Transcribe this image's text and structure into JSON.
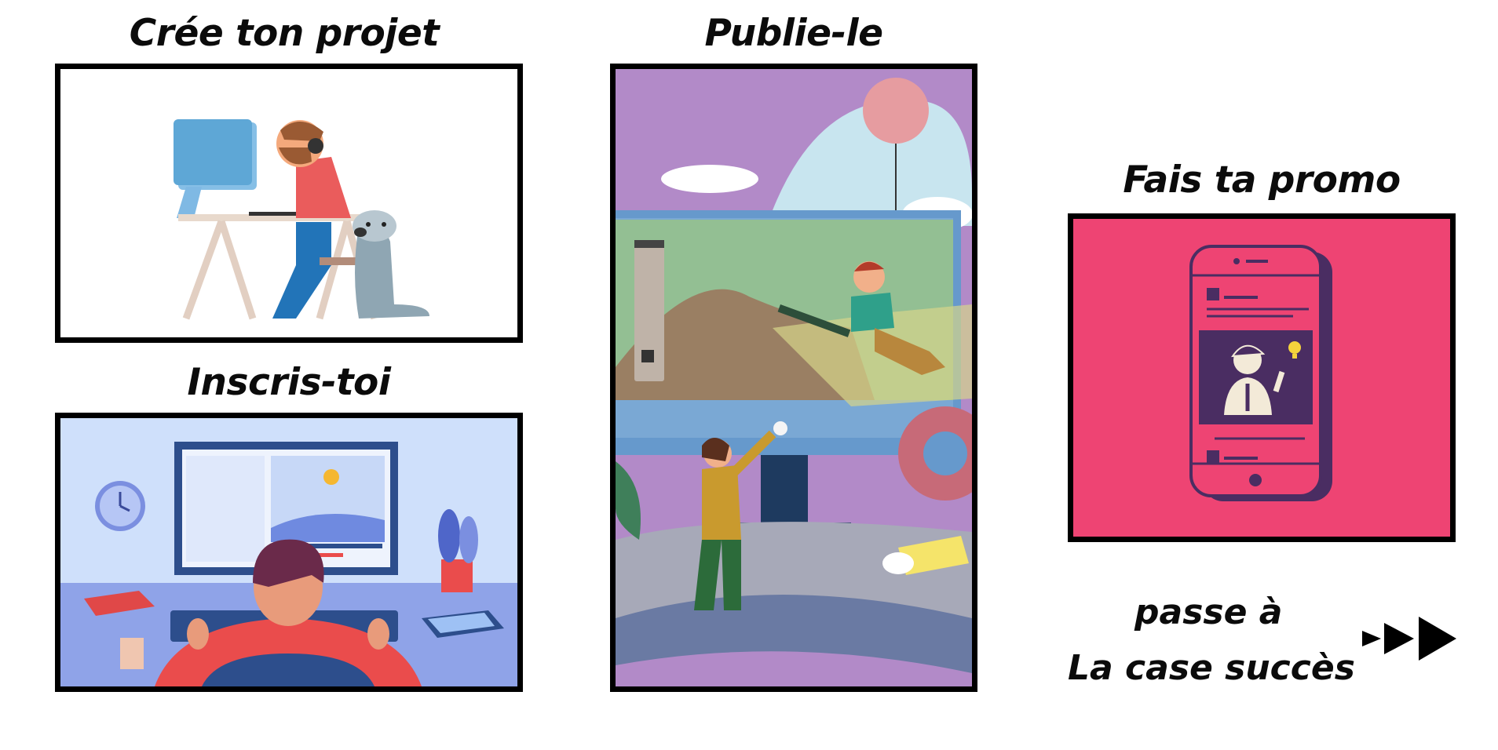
{
  "steps": [
    {
      "title": "Crée ton projet"
    },
    {
      "title": "Inscris-toi"
    },
    {
      "title": "Publie-le"
    },
    {
      "title": "Fais ta promo"
    }
  ],
  "cta": {
    "line1": "passe à",
    "line2": "La case succès",
    "arrow_icon": "triple-play-arrow-icon"
  },
  "colors": {
    "promo_bg": "#ee4473",
    "publish_purple": "#b28ac8",
    "signup_bg": "#cfe0fb"
  }
}
